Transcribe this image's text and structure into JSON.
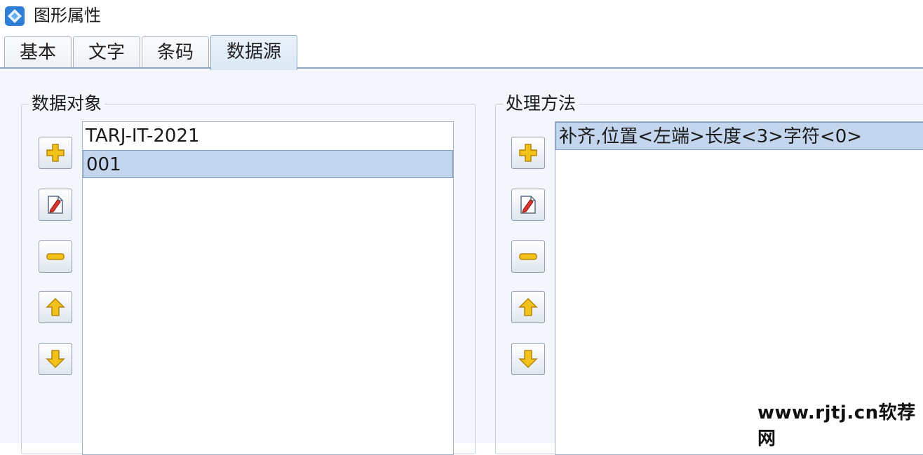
{
  "window": {
    "title": "图形属性"
  },
  "tabs": [
    {
      "label": "基本",
      "active": false
    },
    {
      "label": "文字",
      "active": false
    },
    {
      "label": "条码",
      "active": false
    },
    {
      "label": "数据源",
      "active": true
    }
  ],
  "data_objects": {
    "title": "数据对象",
    "items": [
      {
        "text": "TARJ-IT-2021",
        "selected": false
      },
      {
        "text": "001",
        "selected": true
      }
    ],
    "buttons": [
      "add-icon",
      "edit-icon",
      "remove-icon",
      "move-up-icon",
      "move-down-icon"
    ]
  },
  "processing": {
    "title": "处理方法",
    "items": [
      {
        "text": "补齐,位置<左端>长度<3>字符<0>",
        "selected": true
      }
    ],
    "buttons": [
      "add-icon",
      "edit-icon",
      "remove-icon",
      "move-up-icon",
      "move-down-icon"
    ]
  },
  "watermark": "www.rjtj.cn软荐网",
  "colors": {
    "accent": "#8fa5c0",
    "selection": "#c3d6ee",
    "panel_bg": "#f3f6fa",
    "icon_yellow": "#f2c21a"
  }
}
